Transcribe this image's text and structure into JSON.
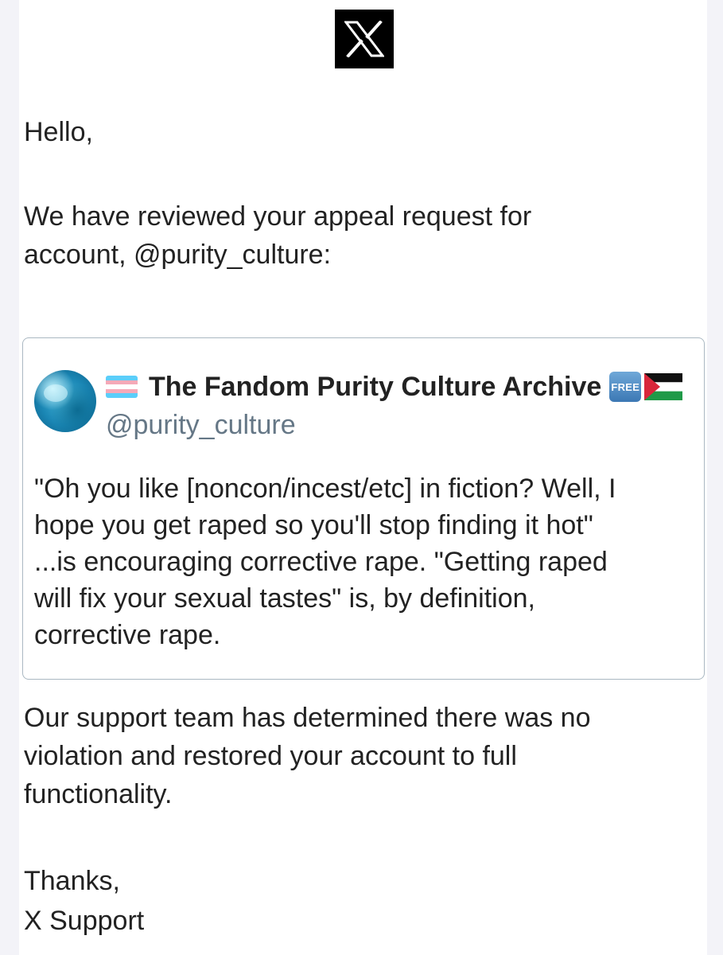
{
  "logo": {
    "icon": "x-logo-icon",
    "background": "#000000",
    "foreground": "#ffffff"
  },
  "email": {
    "greeting": "Hello,",
    "intro": "We have reviewed your appeal request for\naccount, @purity_culture:",
    "result": "Our support team has determined there was no\nviolation and restored your account to full\nfunctionality.",
    "thanks": "Thanks,",
    "signoff": "X Support"
  },
  "tweet": {
    "avatar_icon": "profile-avatar",
    "name_prefix_icon": "transgender-flag-icon",
    "display_name": "The Fandom Purity Culture Archive",
    "free_badge": "FREE",
    "name_suffix_icon": "palestine-flag-icon",
    "handle": "@purity_culture",
    "body": "\"Oh you like [noncon/incest/etc] in fiction? Well, I\nhope you get raped so you'll stop finding it hot\"\n...is encouraging corrective rape. \"Getting raped\nwill fix your sexual tastes\" is, by definition,\ncorrective rape."
  },
  "colors": {
    "text": "#222222",
    "handle": "#657786",
    "card_border": "#aab8c2",
    "page_background": "#f3f3f8"
  }
}
